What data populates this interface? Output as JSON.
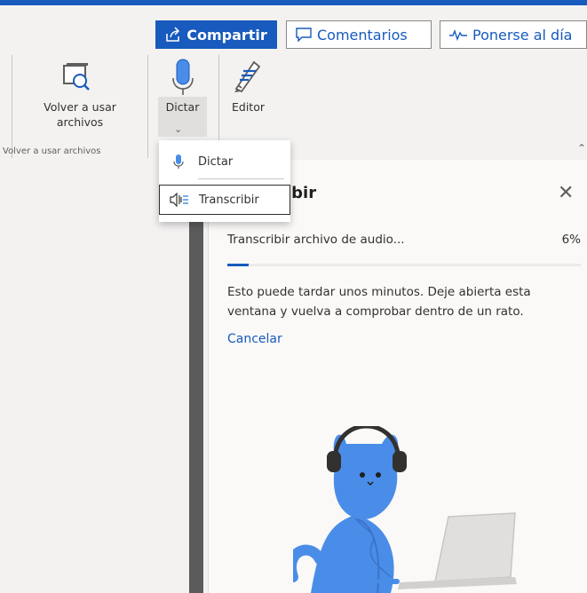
{
  "header": {
    "share_label": "Compartir",
    "comments_label": "Comentarios",
    "catchup_label": "Ponerse al día"
  },
  "ribbon": {
    "reuse": {
      "label_line1": "Volver a usar",
      "label_line2": "archivos",
      "group_name": "Volver a usar archivos"
    },
    "dictate": {
      "label": "Dictar"
    },
    "editor": {
      "label": "Editor"
    }
  },
  "dictate_menu": {
    "items": [
      {
        "label": "Dictar",
        "icon": "microphone-icon"
      },
      {
        "label": "Transcribir",
        "icon": "transcribe-icon"
      }
    ]
  },
  "transcribe_pane": {
    "title": "ibir",
    "progress_label": "Transcribir archivo de audio...",
    "progress_percent_text": "6%",
    "progress_value": 0.06,
    "message": "Esto puede tardar unos minutos. Deje abierta esta ventana y vuelva a comprobar dentro de un rato.",
    "cancel_label": "Cancelar"
  },
  "colors": {
    "accent": "#185abd",
    "illustration": "#4a8de8"
  }
}
